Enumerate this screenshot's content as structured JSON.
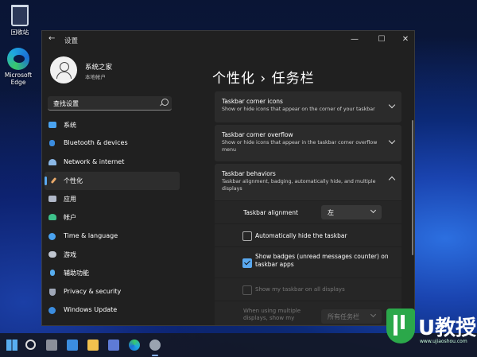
{
  "desktop": {
    "icons": [
      {
        "label": "回收站",
        "icon": "recycle-bin-icon"
      },
      {
        "label": "Microsoft Edge",
        "icon": "edge-icon"
      }
    ]
  },
  "window": {
    "title": "设置",
    "back_glyph": "←",
    "minimize_glyph": "—",
    "maximize_glyph": "☐",
    "close_glyph": "✕"
  },
  "profile": {
    "name": "系统之家",
    "subtitle": "本地帐户"
  },
  "search": {
    "value": "查找设置"
  },
  "nav": {
    "items": [
      {
        "label": "系统",
        "icon": "monitor-icon",
        "color": "#4aa3f0",
        "active": false
      },
      {
        "label": "Bluetooth & devices",
        "icon": "bluetooth-icon",
        "color": "#3b8de0",
        "active": false
      },
      {
        "label": "Network & internet",
        "icon": "wifi-icon",
        "color": "#8ab8e6",
        "active": false
      },
      {
        "label": "个性化",
        "icon": "brush-icon",
        "color": "#e8a96a",
        "active": true
      },
      {
        "label": "应用",
        "icon": "apps-icon",
        "color": "#b0b8c8",
        "active": false
      },
      {
        "label": "帐户",
        "icon": "person-icon",
        "color": "#3dc18a",
        "active": false
      },
      {
        "label": "Time & language",
        "icon": "globe-clock-icon",
        "color": "#4aa3f0",
        "active": false
      },
      {
        "label": "游戏",
        "icon": "gamepad-icon",
        "color": "#c0c6d0",
        "active": false
      },
      {
        "label": "辅助功能",
        "icon": "accessibility-icon",
        "color": "#58aef0",
        "active": false
      },
      {
        "label": "Privacy & security",
        "icon": "shield-icon",
        "color": "#a0a8b8",
        "active": false
      },
      {
        "label": "Windows Update",
        "icon": "update-icon",
        "color": "#3b8de0",
        "active": false
      }
    ]
  },
  "page": {
    "title": "个性化 › 任务栏"
  },
  "cards": {
    "corner_icons": {
      "title": "Taskbar corner icons",
      "desc": "Show or hide icons that appear on the corner of your taskbar"
    },
    "corner_overflow": {
      "title": "Taskbar corner overflow",
      "desc": "Show or hide icons that appear in the taskbar corner overflow menu"
    },
    "behaviors": {
      "title": "Taskbar behaviors",
      "desc": "Taskbar alignment, badging, automatically hide, and multiple displays"
    }
  },
  "behaviors": {
    "alignment_label": "Taskbar alignment",
    "alignment_value": "左",
    "auto_hide_label": "Automatically hide the taskbar",
    "auto_hide_checked": false,
    "badges_label": "Show badges (unread messages counter) on taskbar apps",
    "badges_checked": true,
    "all_displays_label": "Show my taskbar on all displays",
    "all_displays_checked": false,
    "multi_display_label": "When using multiple displays, show my",
    "multi_display_value": "所有任务栏"
  },
  "watermark": {
    "text": "U教授",
    "url": "www.ujiaoshou.com"
  },
  "colors": {
    "accent": "#5aa8ef",
    "window_bg": "#202020",
    "card_bg": "#2b2b2b"
  }
}
